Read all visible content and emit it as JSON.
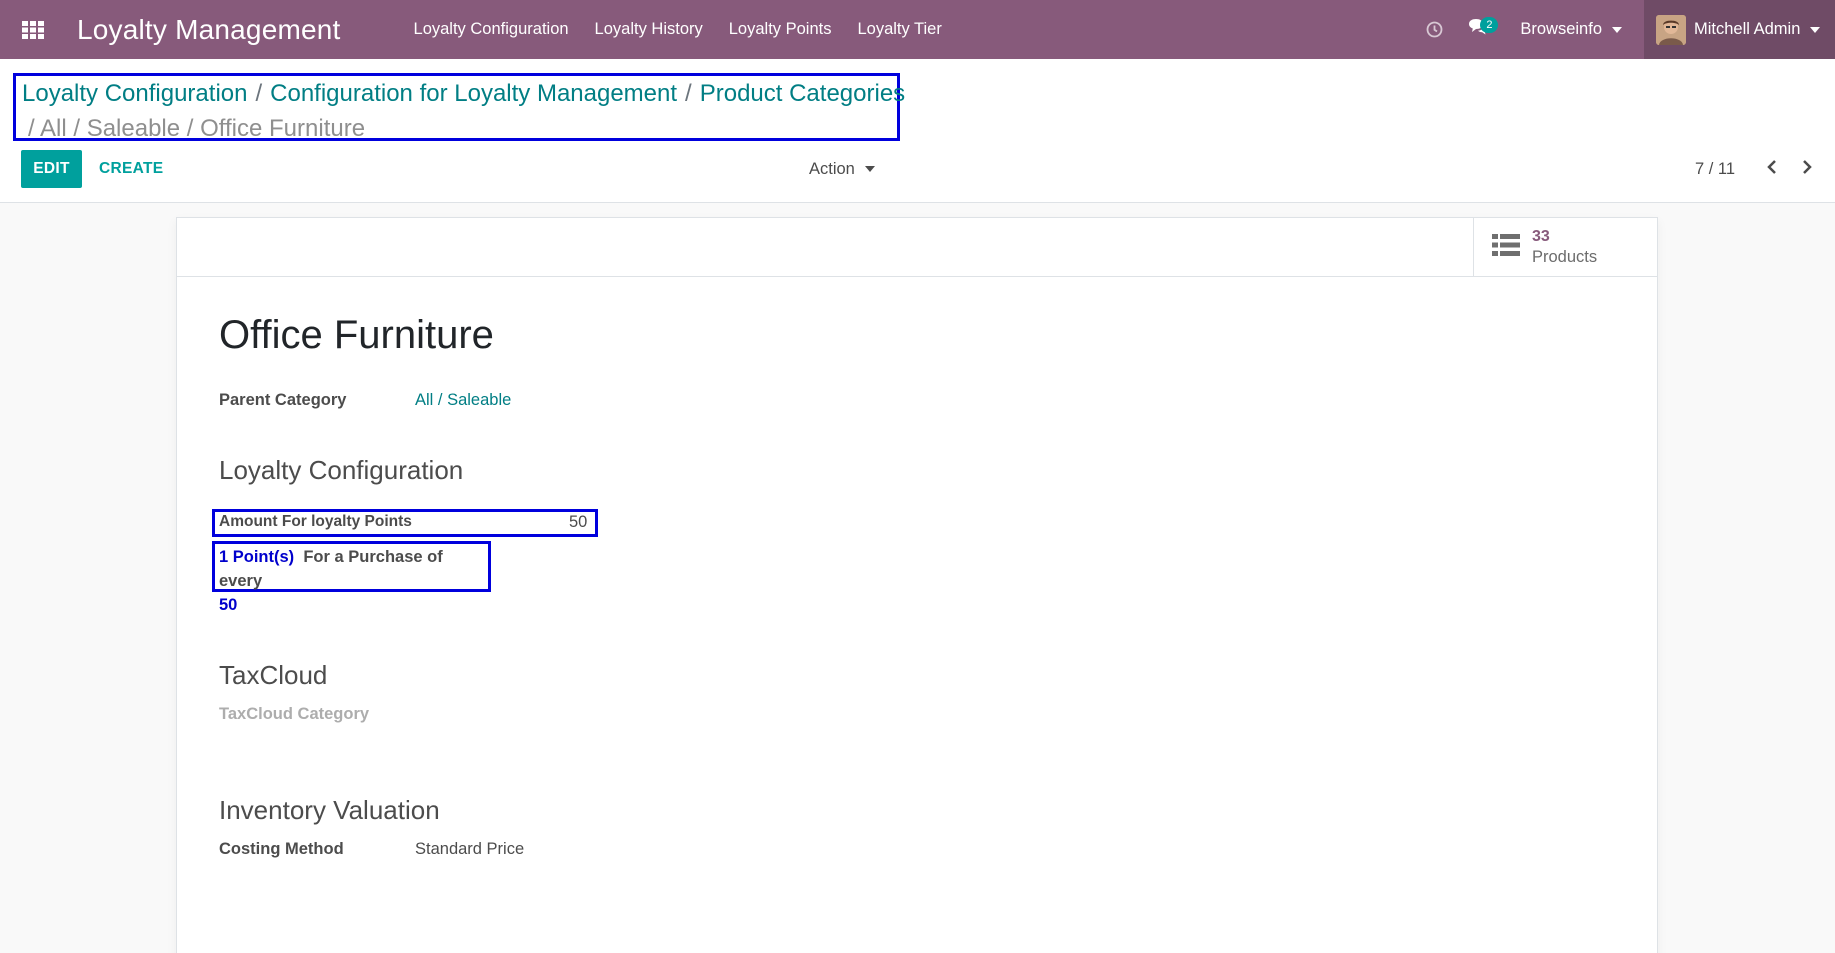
{
  "navbar": {
    "brand": "Loyalty Management",
    "menu": [
      "Loyalty Configuration",
      "Loyalty History",
      "Loyalty Points",
      "Loyalty Tier"
    ],
    "messages_count": "2",
    "company": "Browseinfo",
    "user": "Mitchell Admin",
    "color": "#875a7b"
  },
  "breadcrumb": {
    "items": [
      "Loyalty Configuration",
      "Configuration for Loyalty Management",
      "Product Categories"
    ],
    "current": "/ All / Saleable / Office Furniture"
  },
  "buttons": {
    "edit": "EDIT",
    "create": "CREATE",
    "action": "Action"
  },
  "pager": {
    "value": "7 / 11"
  },
  "smart_button": {
    "value": "33",
    "label": "Products"
  },
  "record": {
    "name": "Office Furniture",
    "parent_category_label": "Parent Category",
    "parent_category_value": "All / Saleable"
  },
  "loyalty": {
    "section_title": "Loyalty Configuration",
    "amount_label": "Amount For loyalty Points",
    "amount_value": "50",
    "points_text": "1 Point(s)",
    "purchase_text": "For a Purchase of every",
    "purchase_value": "50"
  },
  "taxcloud": {
    "section_title": "TaxCloud",
    "category_label": "TaxCloud Category"
  },
  "inventory": {
    "section_title": "Inventory Valuation",
    "costing_label": "Costing Method",
    "costing_value": "Standard Price"
  },
  "colors": {
    "accent": "#00a09d",
    "link": "#017e84",
    "highlight": "#0000dd"
  }
}
